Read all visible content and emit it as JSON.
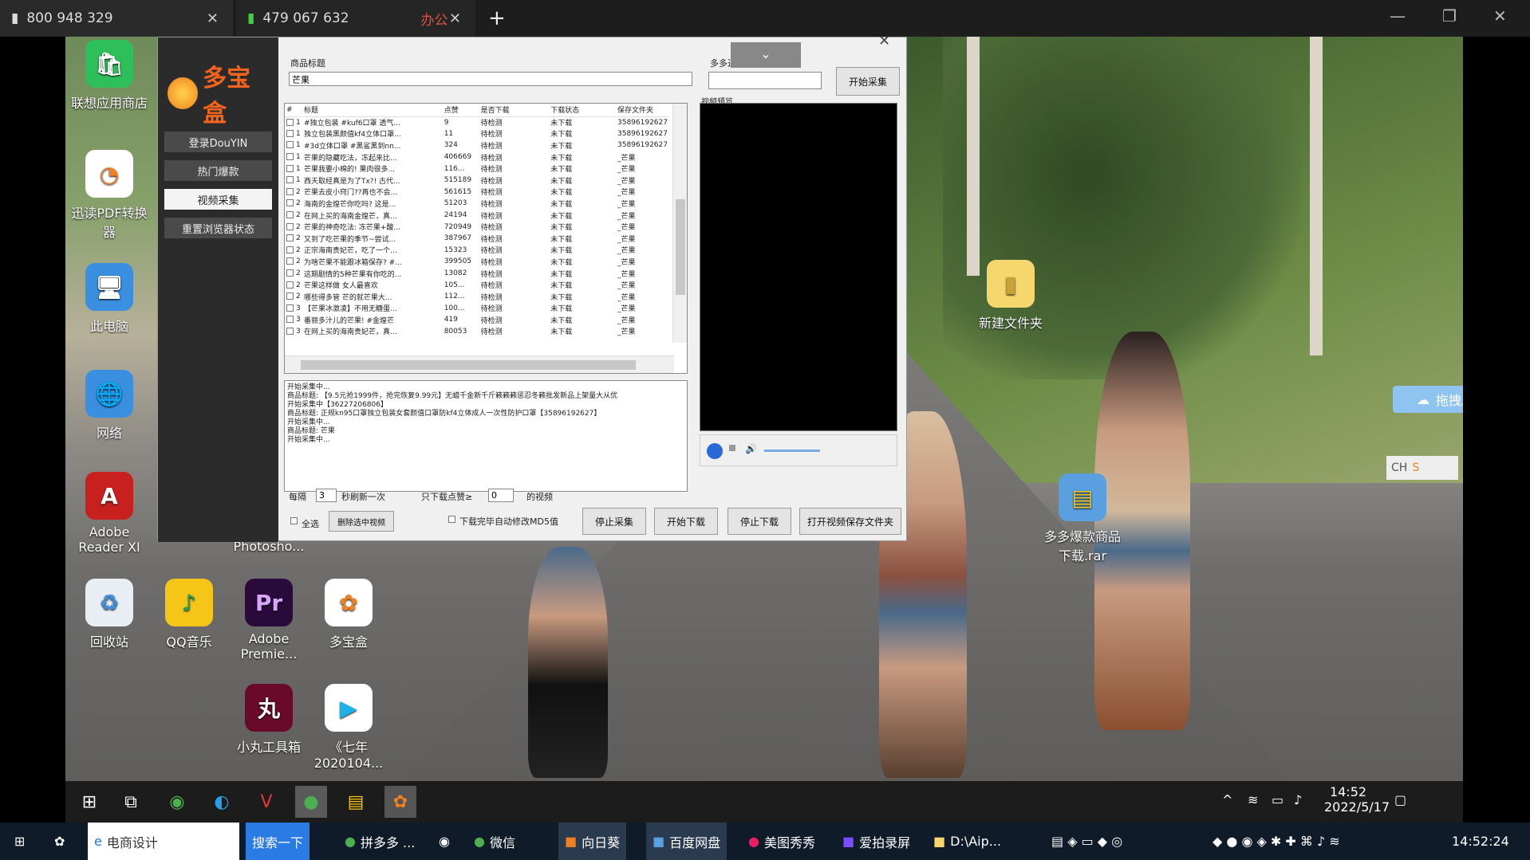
{
  "top_tabs": [
    {
      "label": "800 948 329"
    },
    {
      "label": "479 067 632",
      "tag": "办公"
    }
  ],
  "desktop_icons": [
    {
      "name": "lenovo-store",
      "label": "联想应用商店",
      "badge": "9"
    },
    {
      "name": "pdf-converter",
      "label": "迅读PDF转换器"
    },
    {
      "name": "this-pc",
      "label": "此电脑"
    },
    {
      "name": "network",
      "label": "网络"
    },
    {
      "name": "adobe-reader",
      "label": "Adobe Reader XI"
    },
    {
      "name": "photoshop",
      "label": "Photosho..."
    },
    {
      "name": "recycle",
      "label": "回收站"
    },
    {
      "name": "qq-music",
      "label": "QQ音乐"
    },
    {
      "name": "premiere",
      "label": "Adobe Premie..."
    },
    {
      "name": "duobaohe",
      "label": "多宝盒"
    },
    {
      "name": "xiaowan",
      "label": "小丸工具箱"
    },
    {
      "name": "qishi",
      "label": "《七年 2020104..."
    },
    {
      "name": "new-folder",
      "label": "新建文件夹"
    },
    {
      "name": "rar",
      "label": "多多爆款商品 下载.rar"
    }
  ],
  "app": {
    "logo": "多宝盒",
    "side_buttons": [
      "登录DouYIN",
      "热门爆款",
      "视频采集",
      "重置浏览器状态"
    ],
    "title_label": "商品标题",
    "title_value": "芒果",
    "shop_label": "多多进宝ID",
    "start_btn": "开始采集",
    "preview_label": "视频预览",
    "columns": [
      "#",
      "标题",
      "点赞",
      "是否下载",
      "下载状态",
      "保存文件夹"
    ],
    "rows": [
      [
        "1",
        "#独立包装 #kuf6口罩 透气...",
        "9",
        "待检测",
        "未下载",
        "35896192627"
      ],
      [
        "1",
        "独立包装黑颜值kf4立体口罩...",
        "11",
        "待检测",
        "未下载",
        "35896192627"
      ],
      [
        "1",
        "#3d立体口罩 #黑鲨黑到nn...",
        "324",
        "待检测",
        "未下载",
        "35896192627"
      ],
      [
        "1",
        "芒果的隐藏吃法，冻起来比...",
        "406669",
        "待检测",
        "未下载",
        "_芒果"
      ],
      [
        "1",
        "芒果我要小棉的! 果肉很多...",
        "116...",
        "待检测",
        "未下载",
        "_芒果"
      ],
      [
        "1",
        "西天取经真是为了Tx?! 古代...",
        "515189",
        "待检测",
        "未下载",
        "_芒果"
      ],
      [
        "2",
        "芒果去皮小窍门??再也不会...",
        "561615",
        "待检测",
        "未下载",
        "_芒果"
      ],
      [
        "2",
        "海南的金煌芒你吃吗? 这是...",
        "51203",
        "待检测",
        "未下载",
        "_芒果"
      ],
      [
        "2",
        "在网上买的海南金煌芒，真...",
        "24194",
        "待检测",
        "未下载",
        "_芒果"
      ],
      [
        "2",
        "芒果的神奇吃法: 冻芒果+酸...",
        "720949",
        "待检测",
        "未下载",
        "_芒果"
      ],
      [
        "2",
        "又到了吃芒果的季节~尝试...",
        "387967",
        "待检测",
        "未下载",
        "_芒果"
      ],
      [
        "2",
        "正宗海南贵妃芒，吃了一个...",
        "15323",
        "待检测",
        "未下载",
        "_芒果"
      ],
      [
        "2",
        "为啥芒果不能跟冰箱保存? #...",
        "399505",
        "待检测",
        "未下载",
        "_芒果"
      ],
      [
        "2",
        "这期剧情的5种芒果有你吃的...",
        "13082",
        "待检测",
        "未下载",
        "_芒果"
      ],
      [
        "2",
        "芒果这样做 女人最喜欢",
        "105...",
        "待检测",
        "未下载",
        "_芒果"
      ],
      [
        "2",
        "哪些得多管 芒的就芒果大...",
        "112...",
        "待检测",
        "未下载",
        "_芒果"
      ],
      [
        "3",
        "【芒果冰激凌】不用无糖蛋...",
        "100...",
        "待检测",
        "未下载",
        "_芒果"
      ],
      [
        "3",
        "番丽多汁儿的芒果! #金煌芒",
        "419",
        "待检测",
        "未下载",
        "_芒果"
      ],
      [
        "3",
        "在网上买的海南贵妃芒，真...",
        "80053",
        "待检测",
        "未下载",
        "_芒果"
      ]
    ],
    "log_lines": [
      "开始采集中...",
      "商品标题: 【9.5元抢1999件，抢完恢复9.99元】无蜡千金新千斤籁籁籁惩忍冬籁批发新品上架量大从优",
      "开始采集中【36227206806】",
      "商品标题: 正规kn95口罩独立包装女套颜值口罩防kf4立体成人一次性防护口罩【35896192627】",
      "开始采集中...",
      "商品标题: 芒果",
      "开始采集中..."
    ],
    "interval_label": "每隔",
    "interval_value": "3",
    "interval_suffix": "秒刷新一次",
    "min_likes_label": "只下载点赞≥",
    "min_likes_value": "0",
    "min_likes_suffix": "的视频",
    "select_all": "全选",
    "delete_selected": "删除选中视频",
    "md5_option": "下载完毕自动修改MD5值",
    "stop_collect": "停止采集",
    "start_download": "开始下载",
    "stop_download": "停止下载",
    "open_folder": "打开视频保存文件夹"
  },
  "upload_widget": "拖拽上传",
  "ime": "CH",
  "taskbar": {
    "time": "14:52",
    "date": "2022/5/17"
  },
  "bottom_bar": {
    "items": [
      "电商设计",
      "搜索一下",
      "拼多多 ...",
      "微信",
      "向日葵",
      "百度网盘",
      "美图秀秀",
      "爱拍录屏",
      "D:\\Aip..."
    ],
    "clock": "14:52:24"
  }
}
